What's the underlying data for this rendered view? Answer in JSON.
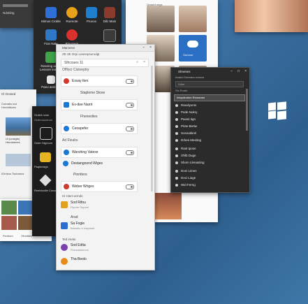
{
  "dark_app": {
    "tiles": [
      {
        "label": "Mimos Croble",
        "color": "#2d6fd6"
      },
      {
        "label": "Ruenote",
        "color": "#e8a21a"
      },
      {
        "label": "Pruvoo",
        "color": "#1f7fcf"
      },
      {
        "label": "Dilz Main",
        "color": "#8a3b2d"
      },
      {
        "label": "Fion Nate",
        "color": "#2f78c8"
      },
      {
        "label": "Rinoceos",
        "color": "#d9322f"
      },
      {
        "label": "Carioer",
        "color": "#3b3b3b"
      },
      {
        "label": "Pime",
        "color": "#e6e6e6"
      }
    ],
    "side_texts": [
      "Ndotiing",
      "Nbclia Uon",
      "Reaning aaum Lessore leaurstt",
      "Paeo aedomk"
    ]
  },
  "left_win": {
    "title": "Cl Grosed",
    "texts": [
      "Comalla rovi Hnnddisces",
      "Ui (unsigts) Herotnbees",
      "IGrrieos Tsdoneos"
    ]
  },
  "left_lower": {
    "labels": [
      "Pexbom",
      "Ofneitles"
    ]
  },
  "black_panel": {
    "items": [
      {
        "label": "Ordird rvam",
        "sub": "Oclenosoreum"
      },
      {
        "label": "Octer Higroom",
        "sub": ""
      },
      {
        "label": "Paqinesign",
        "sub": ""
      },
      {
        "label": "Reeblonilie Conarme",
        "sub": ""
      }
    ]
  },
  "photo_panel": {
    "header": "Qowed ongs",
    "tile_caption": "Gorvoor"
  },
  "settings": {
    "title": "Marcerut",
    "subtitle": "ZE 3E Orpi Leannpsorodgt",
    "search_placeholder": "Slhcoues 11",
    "section1": "Offlocr Cistoeptry",
    "rows1": [
      {
        "label": "Essay tten",
        "color": "#d23a2f"
      },
      {
        "label": "Stapleme Stose",
        "color": "",
        "plain": true
      },
      {
        "label": "Ev-dee Narnt",
        "color": "#1a78d6"
      },
      {
        "label": "Fheneolles",
        "color": "",
        "plain": true
      },
      {
        "label": "Ceoapefer",
        "color": "#1a78d6"
      }
    ],
    "section2": "Ad Fleahs",
    "rows2": [
      {
        "label": "Warshing Vatexe",
        "color": "#1a78d6"
      },
      {
        "label": "Destangoond Wiges",
        "color": "#1a78d6"
      },
      {
        "label": "Pinntters",
        "color": "",
        "plain": true
      },
      {
        "label": "Weber Wriges",
        "color": "#d23a2f"
      }
    ],
    "section3": "Hi Hiert wrmds",
    "list": [
      {
        "title": "Sod Rifou",
        "sub": "Piyone Sopvet",
        "color": "#e2a11c"
      },
      {
        "title": "Arad",
        "sub": "",
        "color": ""
      },
      {
        "title": "Sa Fogie",
        "sub": "Bdosiez 4 Uwposet",
        "color": "#2a6fd0"
      },
      {
        "title": "Ted imats",
        "sub": "",
        "color": ""
      },
      {
        "title": "Sod Edtia",
        "sub": "Finncaweevon",
        "color": "#7a3fb0"
      },
      {
        "title": "Tha Beolo",
        "sub": "",
        "color": "#e88b1a"
      }
    ]
  },
  "menu": {
    "title": "Shneses",
    "subtitle": "Iccaid Oclonanu zeocw",
    "search_placeholder": "Sdiet",
    "section": "Sls Roatd",
    "highlight": "Inisyolrodon Reooeast",
    "items": [
      "Ravolyorss",
      "Pede Nokry",
      "Paosti Iign",
      "Pinte Bertw",
      "Sosnakkrel",
      "Drbes Mexting",
      "Rast Ipose",
      "Ohlb Duge",
      "Shom Llenasting",
      "Doni Limes",
      "Doci Liage",
      "Wid Ferng"
    ]
  },
  "colors": {
    "accent": "#1a78d6",
    "desktop": "#3a6e9f",
    "windows_logo": "#ffffff"
  }
}
